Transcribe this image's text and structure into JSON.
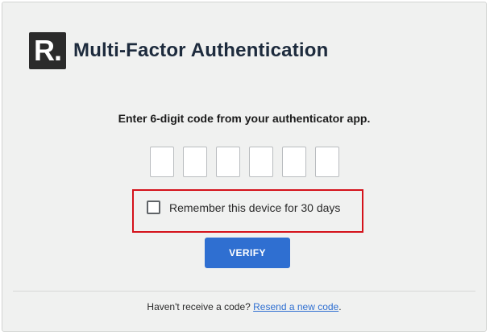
{
  "header": {
    "logo_text": "R.",
    "title": "Multi-Factor Authentication"
  },
  "instruction": "Enter 6-digit code from your authenticator app.",
  "code_inputs": [
    "",
    "",
    "",
    "",
    "",
    ""
  ],
  "remember_device": {
    "label": "Remember this device for 30 days",
    "checked": false
  },
  "verify_label": "VERIFY",
  "footer": {
    "text": "Haven't receive a code?",
    "link_text": "Resend a new code",
    "suffix": "."
  },
  "colors": {
    "primary": "#2f6fd1",
    "highlight_border": "#d4121b",
    "title": "#1d2b3d"
  }
}
